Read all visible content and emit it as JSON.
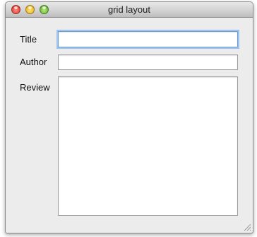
{
  "window": {
    "title": "grid layout"
  },
  "form": {
    "title_label": "Title",
    "title_value": "",
    "author_label": "Author",
    "author_value": "",
    "review_label": "Review",
    "review_value": ""
  },
  "colors": {
    "focus_ring": "#9ec3ee",
    "window_bg": "#ececec"
  }
}
